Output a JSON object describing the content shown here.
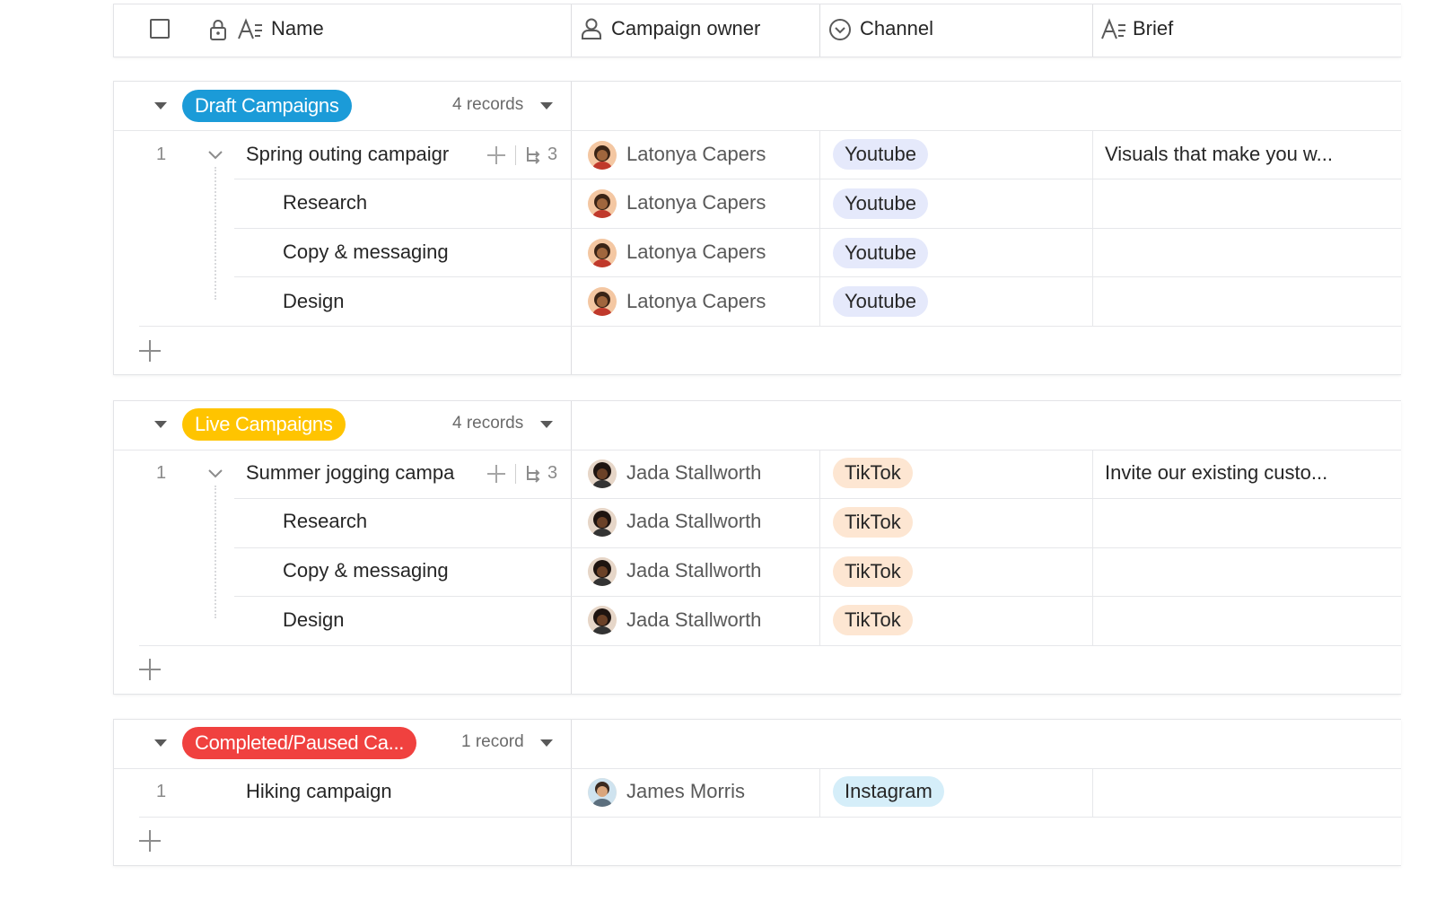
{
  "header": {
    "name_label": "Name",
    "owner_label": "Campaign owner",
    "channel_label": "Channel",
    "brief_label": "Brief"
  },
  "colors": {
    "draft": "#1b9bd8",
    "live": "#ffc400",
    "completed": "#f0413f",
    "youtube_tag": "#e5e9fb",
    "tiktok_tag": "#fde6d2",
    "instagram_tag": "#d5eef9"
  },
  "groups": [
    {
      "label": "Draft Campaigns",
      "records": "4 records",
      "parent": {
        "num": "1",
        "name": "Spring outing campaigr",
        "subcount": "3",
        "owner": "Latonya Capers",
        "channel": "Youtube",
        "brief": "Visuals that make you w..."
      },
      "children": [
        {
          "name": "Research",
          "owner": "Latonya Capers",
          "channel": "Youtube"
        },
        {
          "name": "Copy & messaging",
          "owner": "Latonya Capers",
          "channel": "Youtube"
        },
        {
          "name": "Design",
          "owner": "Latonya Capers",
          "channel": "Youtube"
        }
      ]
    },
    {
      "label": "Live Campaigns",
      "records": "4 records",
      "parent": {
        "num": "1",
        "name": "Summer jogging campa",
        "subcount": "3",
        "owner": "Jada Stallworth",
        "channel": "TikTok",
        "brief": "Invite our existing custo..."
      },
      "children": [
        {
          "name": "Research",
          "owner": "Jada Stallworth",
          "channel": "TikTok"
        },
        {
          "name": "Copy & messaging",
          "owner": "Jada Stallworth",
          "channel": "TikTok"
        },
        {
          "name": "Design",
          "owner": "Jada Stallworth",
          "channel": "TikTok"
        }
      ]
    },
    {
      "label": "Completed/Paused Ca...",
      "records": "1 record",
      "parent": {
        "num": "1",
        "name": "Hiking campaign",
        "owner": "James Morris",
        "channel": "Instagram",
        "brief": ""
      }
    }
  ]
}
